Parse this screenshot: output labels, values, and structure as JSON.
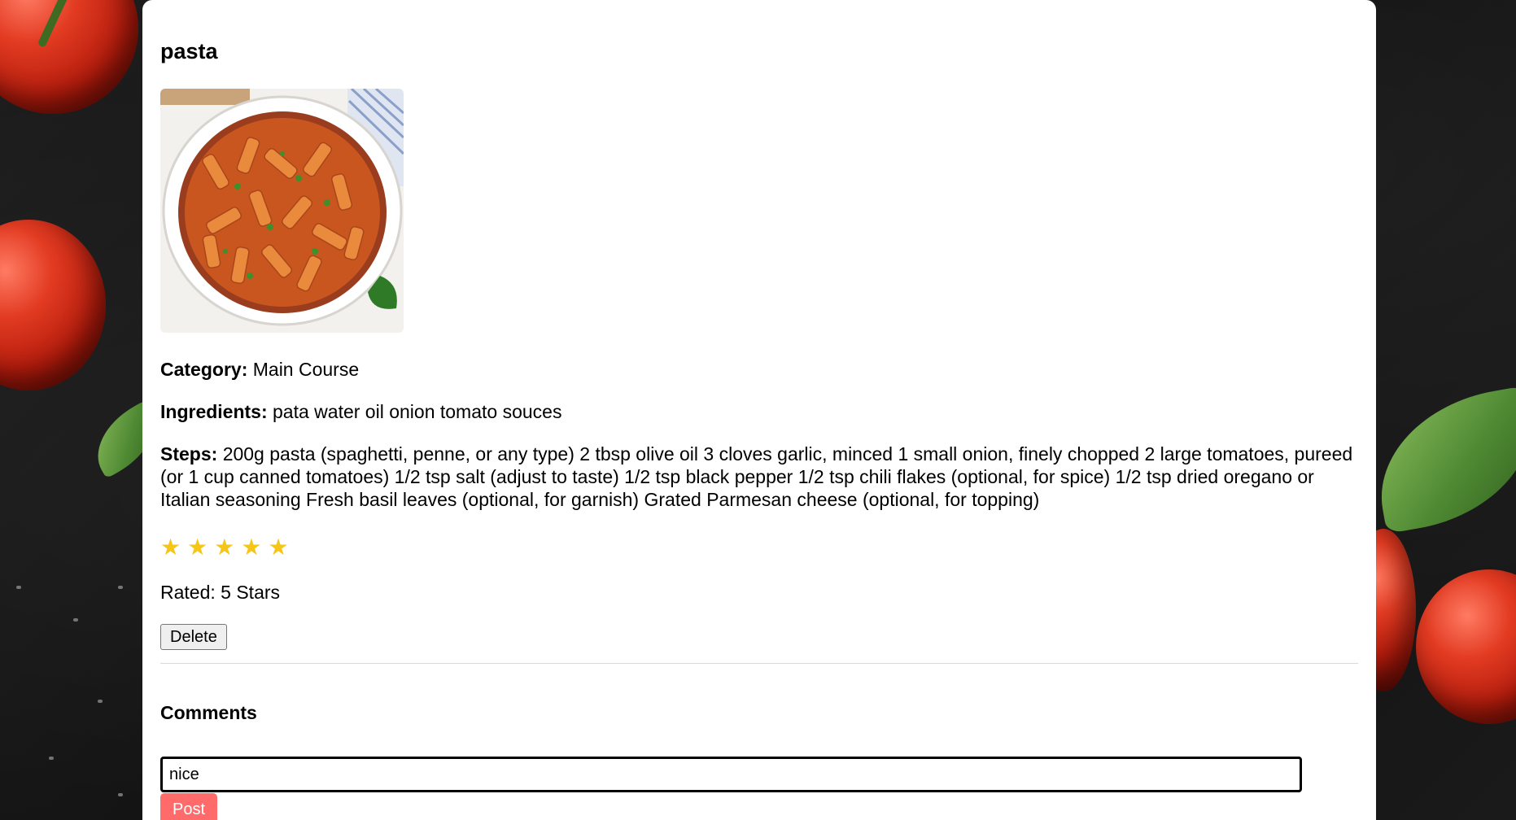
{
  "recipe": {
    "title": "pasta",
    "image_alt": "pasta dish in white pot",
    "category_label": "Category:",
    "category_value": "Main Course",
    "ingredients_label": "Ingredients:",
    "ingredients_value": "pata water oil onion tomato souces",
    "steps_label": "Steps:",
    "steps_value": "200g pasta (spaghetti, penne, or any type) 2 tbsp olive oil 3 cloves garlic, minced 1 small onion, finely chopped 2 large tomatoes, pureed (or 1 cup canned tomatoes) 1/2 tsp salt (adjust to taste) 1/2 tsp black pepper 1/2 tsp chili flakes (optional, for spice) 1/2 tsp dried oregano or Italian seasoning Fresh basil leaves (optional, for garnish) Grated Parmesan cheese (optional, for topping)",
    "rating": {
      "stars": [
        "★",
        "★",
        "★",
        "★",
        "★"
      ],
      "value": 5,
      "max": 5,
      "rated_text": "Rated: 5 Stars"
    },
    "delete_label": "Delete"
  },
  "comments": {
    "heading": "Comments",
    "input_value": "nice",
    "post_label": "Post"
  },
  "colors": {
    "star": "#f5c518",
    "post_button": "#ff6b6b",
    "card": "#ffffff",
    "background": "#151515"
  },
  "icons": {
    "star": "star-icon"
  }
}
